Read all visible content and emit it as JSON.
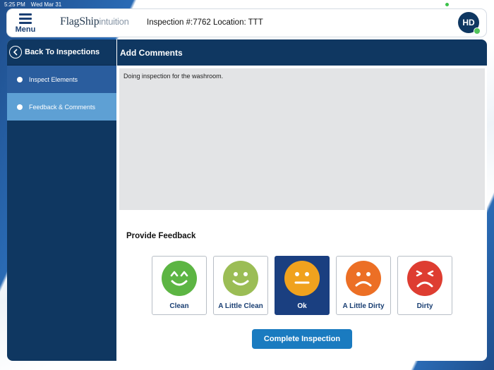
{
  "status_bar": {
    "time": "5:25 PM",
    "date": "Wed Mar 31"
  },
  "header": {
    "menu_label": "Menu",
    "logo_main": "FlagShip",
    "logo_sub": "intuition",
    "title": "Inspection #:7762 Location: TTT",
    "avatar_initials": "HD",
    "online_color": "#52c35a"
  },
  "sidebar": {
    "back_label": "Back To Inspections",
    "items": [
      {
        "label": "Inspect Elements",
        "icon": "dot-icon"
      },
      {
        "label": "Feedback & Comments",
        "icon": "dot-icon"
      }
    ]
  },
  "main": {
    "section_title": "Add Comments",
    "comments_value": "Doing inspection for the washroom.",
    "feedback_title": "Provide Feedback",
    "feedback_options": [
      {
        "label": "Clean",
        "face": "happy-closed-eyes-face-icon",
        "color": "#5cb543",
        "selected": false
      },
      {
        "label": "A Little Clean",
        "face": "smile-face-icon",
        "color": "#9bbd55",
        "selected": false
      },
      {
        "label": "Ok",
        "face": "neutral-face-icon",
        "color": "#f0a21e",
        "selected": true
      },
      {
        "label": "A Little Dirty",
        "face": "frown-face-icon",
        "color": "#ec6f25",
        "selected": false
      },
      {
        "label": "Dirty",
        "face": "angry-face-icon",
        "color": "#de3d31",
        "selected": false
      }
    ],
    "complete_label": "Complete Inspection"
  },
  "colors": {
    "primary": "#0f3761",
    "accent": "#1a7bc0",
    "nav_active": "#5ea0d4",
    "nav_inactive": "#2a5d9e"
  }
}
